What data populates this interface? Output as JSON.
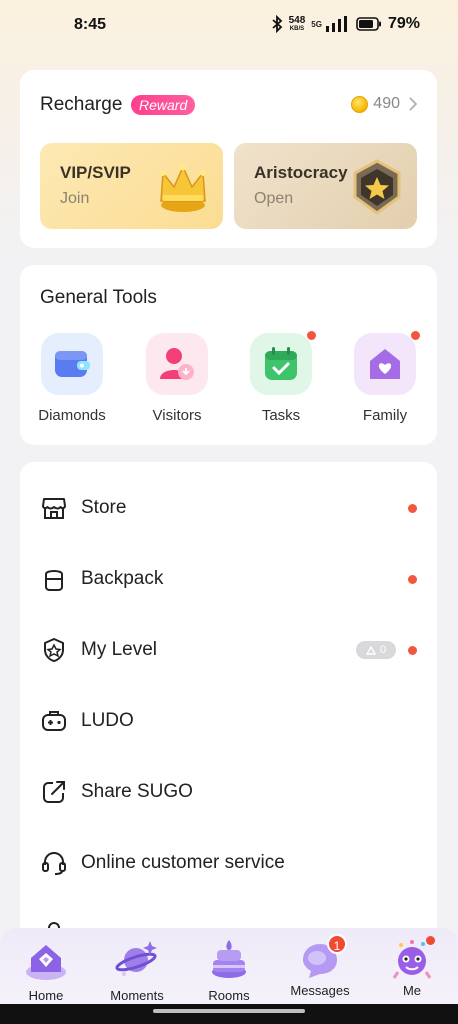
{
  "status_bar": {
    "time": "8:45",
    "net_speed_value": "548",
    "net_speed_unit": "KB/S",
    "network_type": "5G",
    "battery": "79%"
  },
  "recharge": {
    "title": "Recharge",
    "badge": "Reward",
    "coins": "490",
    "tiles": [
      {
        "title": "VIP/SVIP",
        "subtitle": "Join",
        "icon": "crown-icon"
      },
      {
        "title": "Aristocracy",
        "subtitle": "Open",
        "icon": "star-shield-icon"
      }
    ]
  },
  "tools": {
    "title": "General Tools",
    "items": [
      {
        "label": "Diamonds",
        "icon": "wallet-icon",
        "dot": false
      },
      {
        "label": "Visitors",
        "icon": "visitor-icon",
        "dot": false
      },
      {
        "label": "Tasks",
        "icon": "calendar-check-icon",
        "dot": true
      },
      {
        "label": "Family",
        "icon": "house-heart-icon",
        "dot": true
      }
    ]
  },
  "menu": {
    "items": [
      {
        "label": "Store",
        "icon": "store-icon",
        "dot": true
      },
      {
        "label": "Backpack",
        "icon": "backpack-icon",
        "dot": true
      },
      {
        "label": "My Level",
        "icon": "level-shield-icon",
        "dot": true,
        "chip": "0"
      },
      {
        "label": "LUDO",
        "icon": "gamepad-icon",
        "dot": false
      },
      {
        "label": "Share SUGO",
        "icon": "share-icon",
        "dot": false
      },
      {
        "label": "Online customer service",
        "icon": "headset-icon",
        "dot": false
      }
    ]
  },
  "nav": {
    "items": [
      {
        "label": "Home",
        "icon": "home-icon"
      },
      {
        "label": "Moments",
        "icon": "planet-icon"
      },
      {
        "label": "Rooms",
        "icon": "cake-icon"
      },
      {
        "label": "Messages",
        "icon": "chat-bubble-icon",
        "badge": "1"
      },
      {
        "label": "Me",
        "icon": "avatar-icon",
        "dot": true
      }
    ]
  },
  "colors": {
    "accent_red": "#f0573c",
    "reward_pink": "#ff3f8e",
    "vip_tile": "#fbdc92",
    "aristocracy_tile": "#e3cfae",
    "nav_purple": "#8f6be8"
  }
}
